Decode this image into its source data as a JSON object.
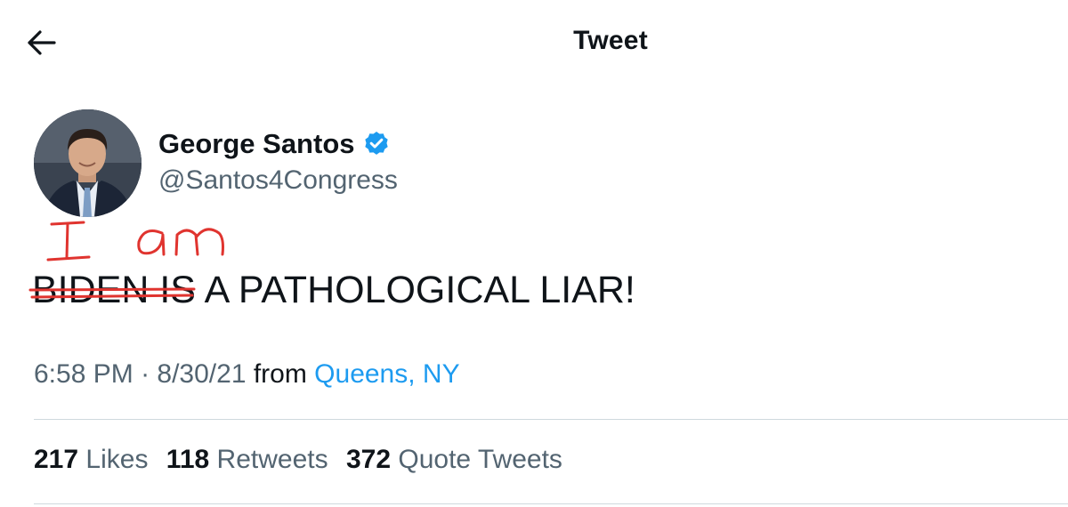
{
  "header": {
    "title": "Tweet",
    "back_icon": "arrow-left-icon"
  },
  "author": {
    "name": "George Santos",
    "handle": "@Santos4Congress",
    "verified_icon": "verified-badge-icon",
    "verified_color": "#1d9bf0"
  },
  "tweet": {
    "handwritten_annotation": "I am",
    "annotation_color": "#e0342f",
    "struck_text": "BIDEN IS",
    "text_rest": " A PATHOLOGICAL LIAR!"
  },
  "meta": {
    "time": "6:58 PM",
    "separator": " · ",
    "date": "8/30/21",
    "from_label": " from ",
    "location": "Queens, NY"
  },
  "stats": [
    {
      "count": "217",
      "label": "Likes"
    },
    {
      "count": "118",
      "label": "Retweets"
    },
    {
      "count": "372",
      "label": "Quote Tweets"
    }
  ],
  "colors": {
    "text_primary": "#0f1419",
    "text_secondary": "#536471",
    "link": "#1d9bf0",
    "divider": "#cfd9de"
  }
}
